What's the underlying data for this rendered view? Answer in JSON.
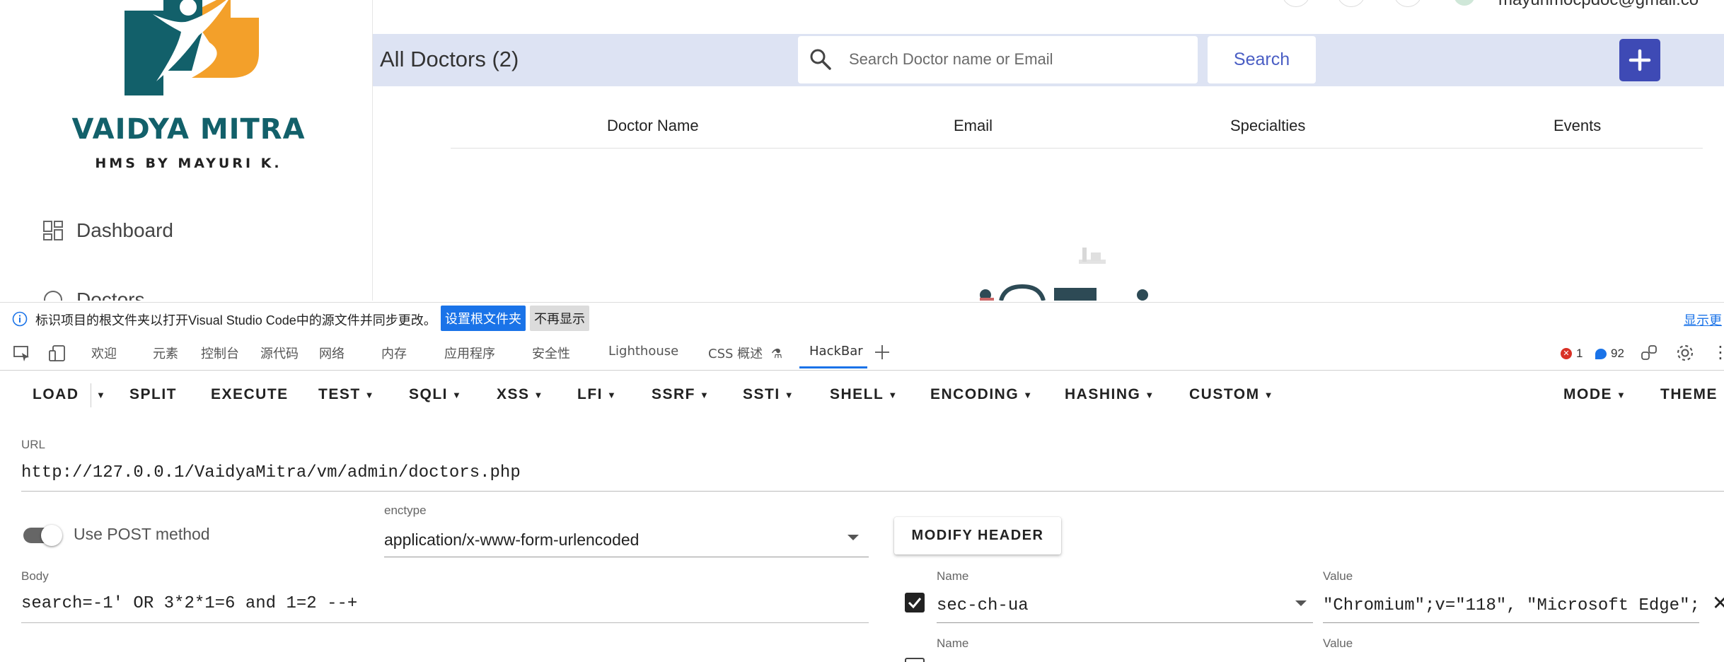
{
  "brand": {
    "name": "VAIDYA MITRA",
    "tagline": "HMS BY MAYURI K.",
    "colors": {
      "teal": "#12606a",
      "orange": "#f3a02a"
    }
  },
  "sidebar": {
    "items": [
      {
        "label": "Dashboard",
        "icon": "grid-icon"
      },
      {
        "label": "Doctors",
        "icon": "doctor-icon"
      }
    ]
  },
  "header": {
    "user_email": "mayurimocpdoc@gmail.co"
  },
  "main": {
    "title": "All Doctors (2)",
    "search": {
      "placeholder": "Search Doctor name or Email",
      "button_label": "Search"
    },
    "add_button_label": "+",
    "table": {
      "columns": [
        "Doctor Name",
        "Email",
        "Specialties",
        "Events"
      ],
      "rows": []
    }
  },
  "infobar": {
    "message": "标识项目的根文件夹以打开Visual Studio Code中的源文件并同步更改。",
    "primary_button": "设置根文件夹",
    "secondary_button": "不再显示",
    "link": "显示更"
  },
  "devtools": {
    "tabs": [
      "欢迎",
      "元素",
      "控制台",
      "源代码",
      "网络",
      "内存",
      "应用程序",
      "安全性",
      "Lighthouse",
      "CSS 概述",
      "HackBar"
    ],
    "active_tab": "HackBar",
    "error_count": "1",
    "message_count": "92"
  },
  "hackbar": {
    "menu": [
      "LOAD",
      "SPLIT",
      "EXECUTE",
      "TEST",
      "SQLI",
      "XSS",
      "LFI",
      "SSRF",
      "SSTI",
      "SHELL",
      "ENCODING",
      "HASHING",
      "CUSTOM",
      "MODE",
      "THEME"
    ],
    "url_label": "URL",
    "url_value": "http://127.0.0.1/VaidyaMitra/vm/admin/doctors.php",
    "post_toggle_label": "Use POST method",
    "post_enabled": true,
    "enctype_label": "enctype",
    "enctype_value": "application/x-www-form-urlencoded",
    "modify_header_label": "MODIFY HEADER",
    "body_label": "Body",
    "body_value": "search=-1' OR 3*2*1=6 and 1=2 --+",
    "headers": [
      {
        "name_label": "Name",
        "value_label": "Value",
        "name": "sec-ch-ua",
        "value": "\"Chromium\";v=\"118\", \"Microsoft Edge\";",
        "enabled": true
      },
      {
        "name_label": "Name",
        "value_label": "Value",
        "name": "",
        "value": "",
        "enabled": false
      }
    ]
  }
}
